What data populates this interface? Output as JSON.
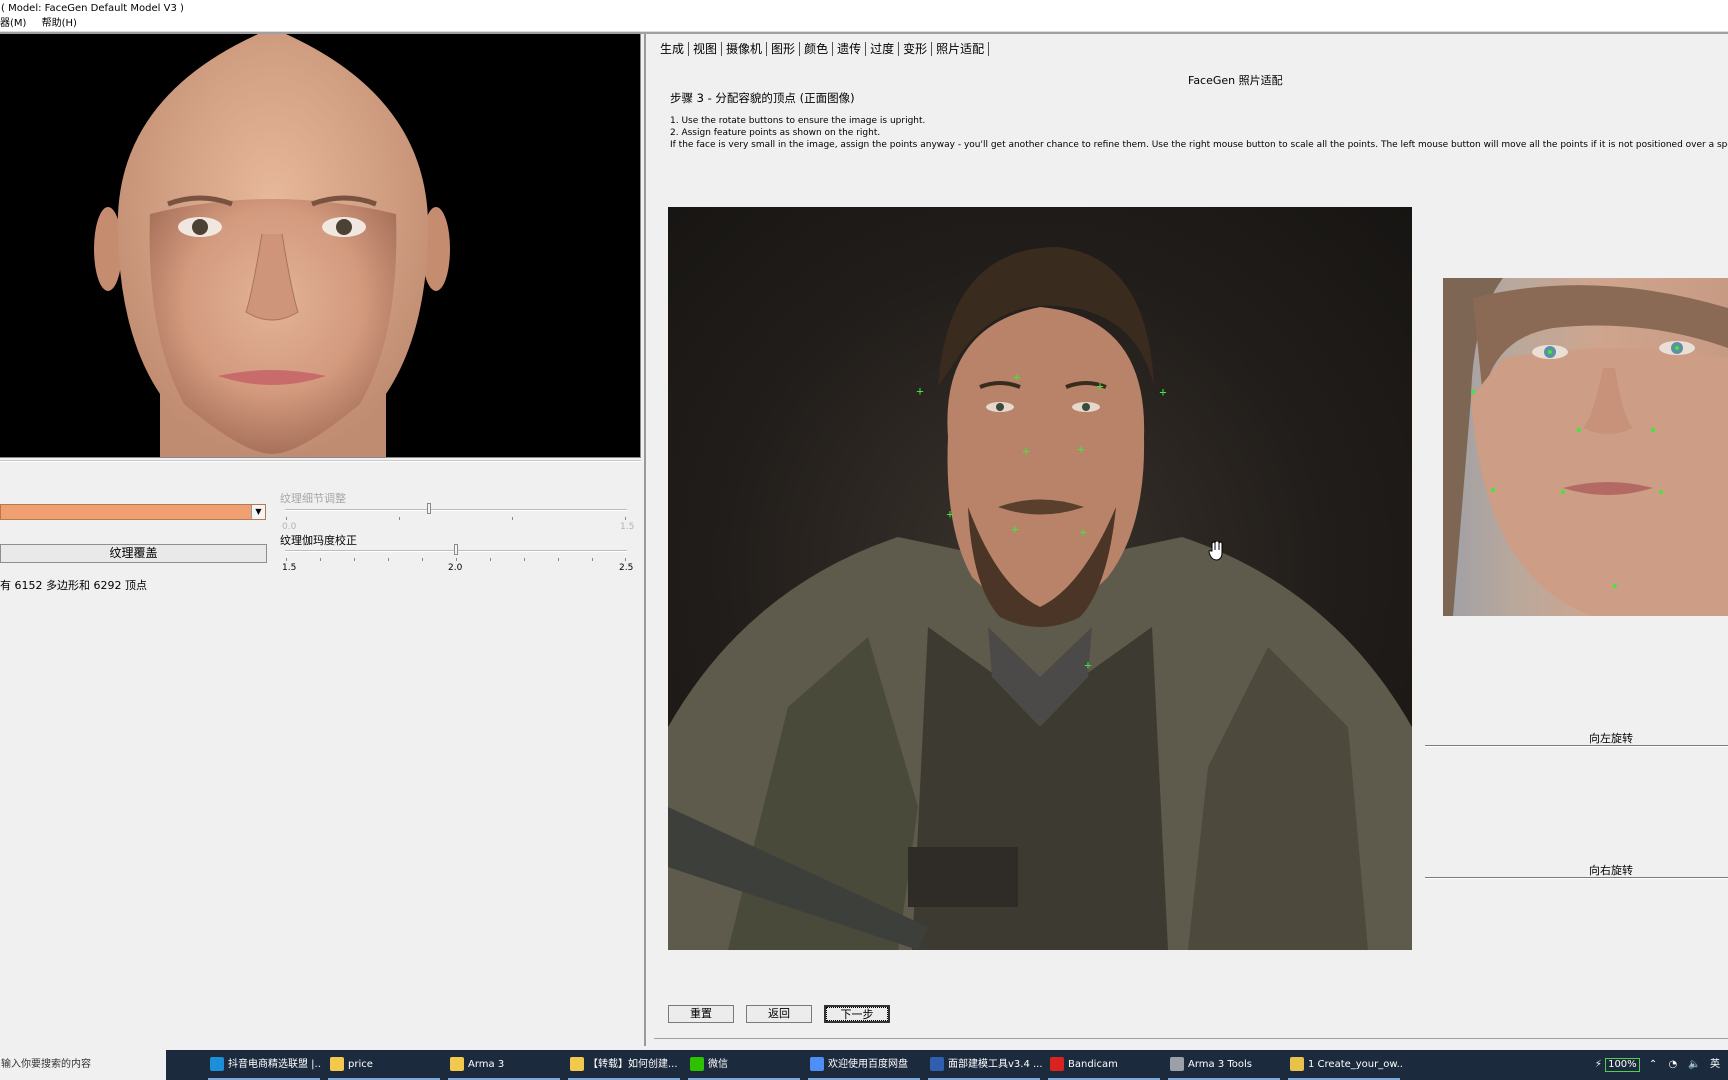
{
  "window": {
    "title": "( Model: FaceGen Default Model V3 )",
    "menu": [
      "器(M)",
      "帮助(H)"
    ]
  },
  "left": {
    "texture_button": "纹理覆盖",
    "poly_info": "有 6152 多边形和 6292 顶点",
    "slider1": {
      "label": "纹理细节调整",
      "min": "0.0",
      "max": "1.5",
      "enabled": false,
      "value_fraction": 0.42
    },
    "slider2": {
      "label": "纹理伽玛度校正",
      "min": "1.5",
      "mid": "2.0",
      "max": "2.5",
      "enabled": true,
      "value": 2.0
    }
  },
  "right": {
    "tabs": [
      "生成",
      "视图",
      "摄像机",
      "图形",
      "颜色",
      "遗传",
      "过度",
      "变形",
      "照片适配"
    ],
    "active_tab": "照片适配",
    "panel_title": "FaceGen 照片适配",
    "step_title": "步骤 3 - 分配容貌的顶点 (正面图像)",
    "instructions": [
      "1. Use the rotate buttons to ensure the image is upright.",
      "2. Assign feature points as shown on the right.",
      "If the face is very small in the image, assign the points anyway - you'll get another chance to refine them. Use the right mouse button to scale all the points. The left mouse button will move all the points if it is not positioned over a specific point."
    ],
    "rotate_left": "向左旋转",
    "rotate_right": "向右旋转",
    "buttons": {
      "reset": "重置",
      "back": "返回",
      "next": "下一步"
    }
  },
  "taskbar": {
    "search_placeholder": "输入你要搜索的内容",
    "items": [
      {
        "label": "抖音电商精选联盟 |...",
        "icon": "edge-icon",
        "color": "#1b8fd8"
      },
      {
        "label": "price",
        "icon": "folder-icon",
        "color": "#f2c94c"
      },
      {
        "label": "Arma 3",
        "icon": "folder-icon",
        "color": "#f2c94c"
      },
      {
        "label": "【转载】如何创建...",
        "icon": "folder-icon",
        "color": "#f2c94c"
      },
      {
        "label": "微信",
        "icon": "wechat-icon",
        "color": "#2dc100"
      },
      {
        "label": "欢迎使用百度网盘",
        "icon": "baidu-netdisk-icon",
        "color": "#4e8ef7"
      },
      {
        "label": "面部建模工具v3.4 ...",
        "icon": "facegen-icon",
        "color": "#2f5fae"
      },
      {
        "label": "Bandicam",
        "icon": "record-icon",
        "color": "#d8231f"
      },
      {
        "label": "Arma 3 Tools",
        "icon": "arma-tools-icon",
        "color": "#9aa0a8"
      },
      {
        "label": "1 Create_your_ow...",
        "icon": "document-icon",
        "color": "#e8c24a"
      }
    ],
    "battery": "100%",
    "ime": "英"
  }
}
